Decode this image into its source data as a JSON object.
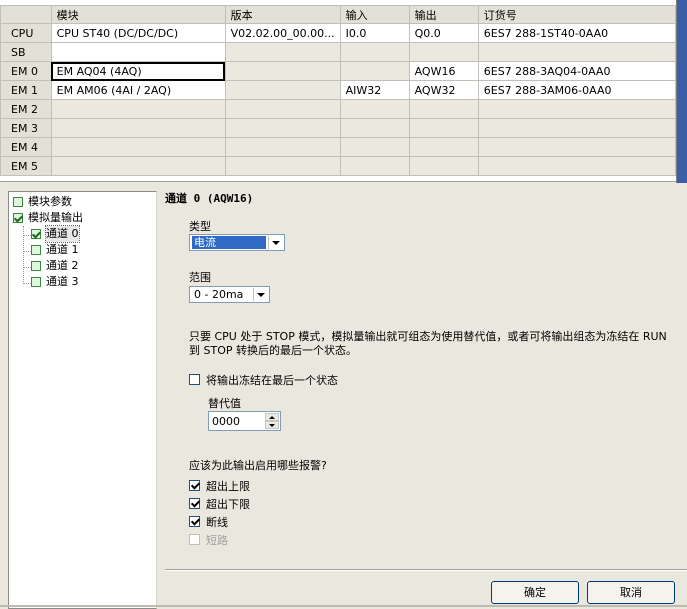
{
  "grid": {
    "headers": [
      "",
      "模块",
      "版本",
      "输入",
      "输出",
      "订货号"
    ],
    "rows": [
      {
        "slot": "CPU",
        "module": "CPU ST40 (DC/DC/DC)",
        "version": "V02.02.00_00.00...",
        "input": "I0.0",
        "output": "Q0.0",
        "order": "6ES7 288-1ST40-0AA0"
      },
      {
        "slot": "SB",
        "module": "",
        "version": "",
        "input": "",
        "output": "",
        "order": ""
      },
      {
        "slot": "EM 0",
        "module": "EM AQ04 (4AQ)",
        "version": "",
        "input": "",
        "output": "AQW16",
        "order": "6ES7 288-3AQ04-0AA0"
      },
      {
        "slot": "EM 1",
        "module": "EM AM06 (4AI / 2AQ)",
        "version": "",
        "input": "AIW32",
        "output": "AQW32",
        "order": "6ES7 288-3AM06-0AA0"
      },
      {
        "slot": "EM 2",
        "module": "",
        "version": "",
        "input": "",
        "output": "",
        "order": ""
      },
      {
        "slot": "EM 3",
        "module": "",
        "version": "",
        "input": "",
        "output": "",
        "order": ""
      },
      {
        "slot": "EM 4",
        "module": "",
        "version": "",
        "input": "",
        "output": "",
        "order": ""
      },
      {
        "slot": "EM 5",
        "module": "",
        "version": "",
        "input": "",
        "output": "",
        "order": ""
      }
    ]
  },
  "tree": {
    "module_params": "模块参数",
    "analog_output": "模拟量输出",
    "channels": [
      "通道 0",
      "通道 1",
      "通道 2",
      "通道 3"
    ]
  },
  "panel": {
    "title": "通道 0 (AQW16)",
    "type_label": "类型",
    "type_value": "电流",
    "range_label": "范围",
    "range_value": "0 - 20ma",
    "description": "只要 CPU 处于 STOP 模式，模拟量输出就可组态为使用替代值，或者可将输出组态为冻结在 RUN 到 STOP 转换后的最后一个状态。",
    "freeze_label": "将输出冻结在最后一个状态",
    "substitute_label": "替代值",
    "substitute_value": "0000",
    "alarms_label": "应该为此输出启用哪些报警?",
    "alarm_upper": "超出上限",
    "alarm_lower": "超出下限",
    "alarm_wire": "断线",
    "alarm_short": "短路"
  },
  "buttons": {
    "ok": "确定",
    "cancel": "取消"
  }
}
